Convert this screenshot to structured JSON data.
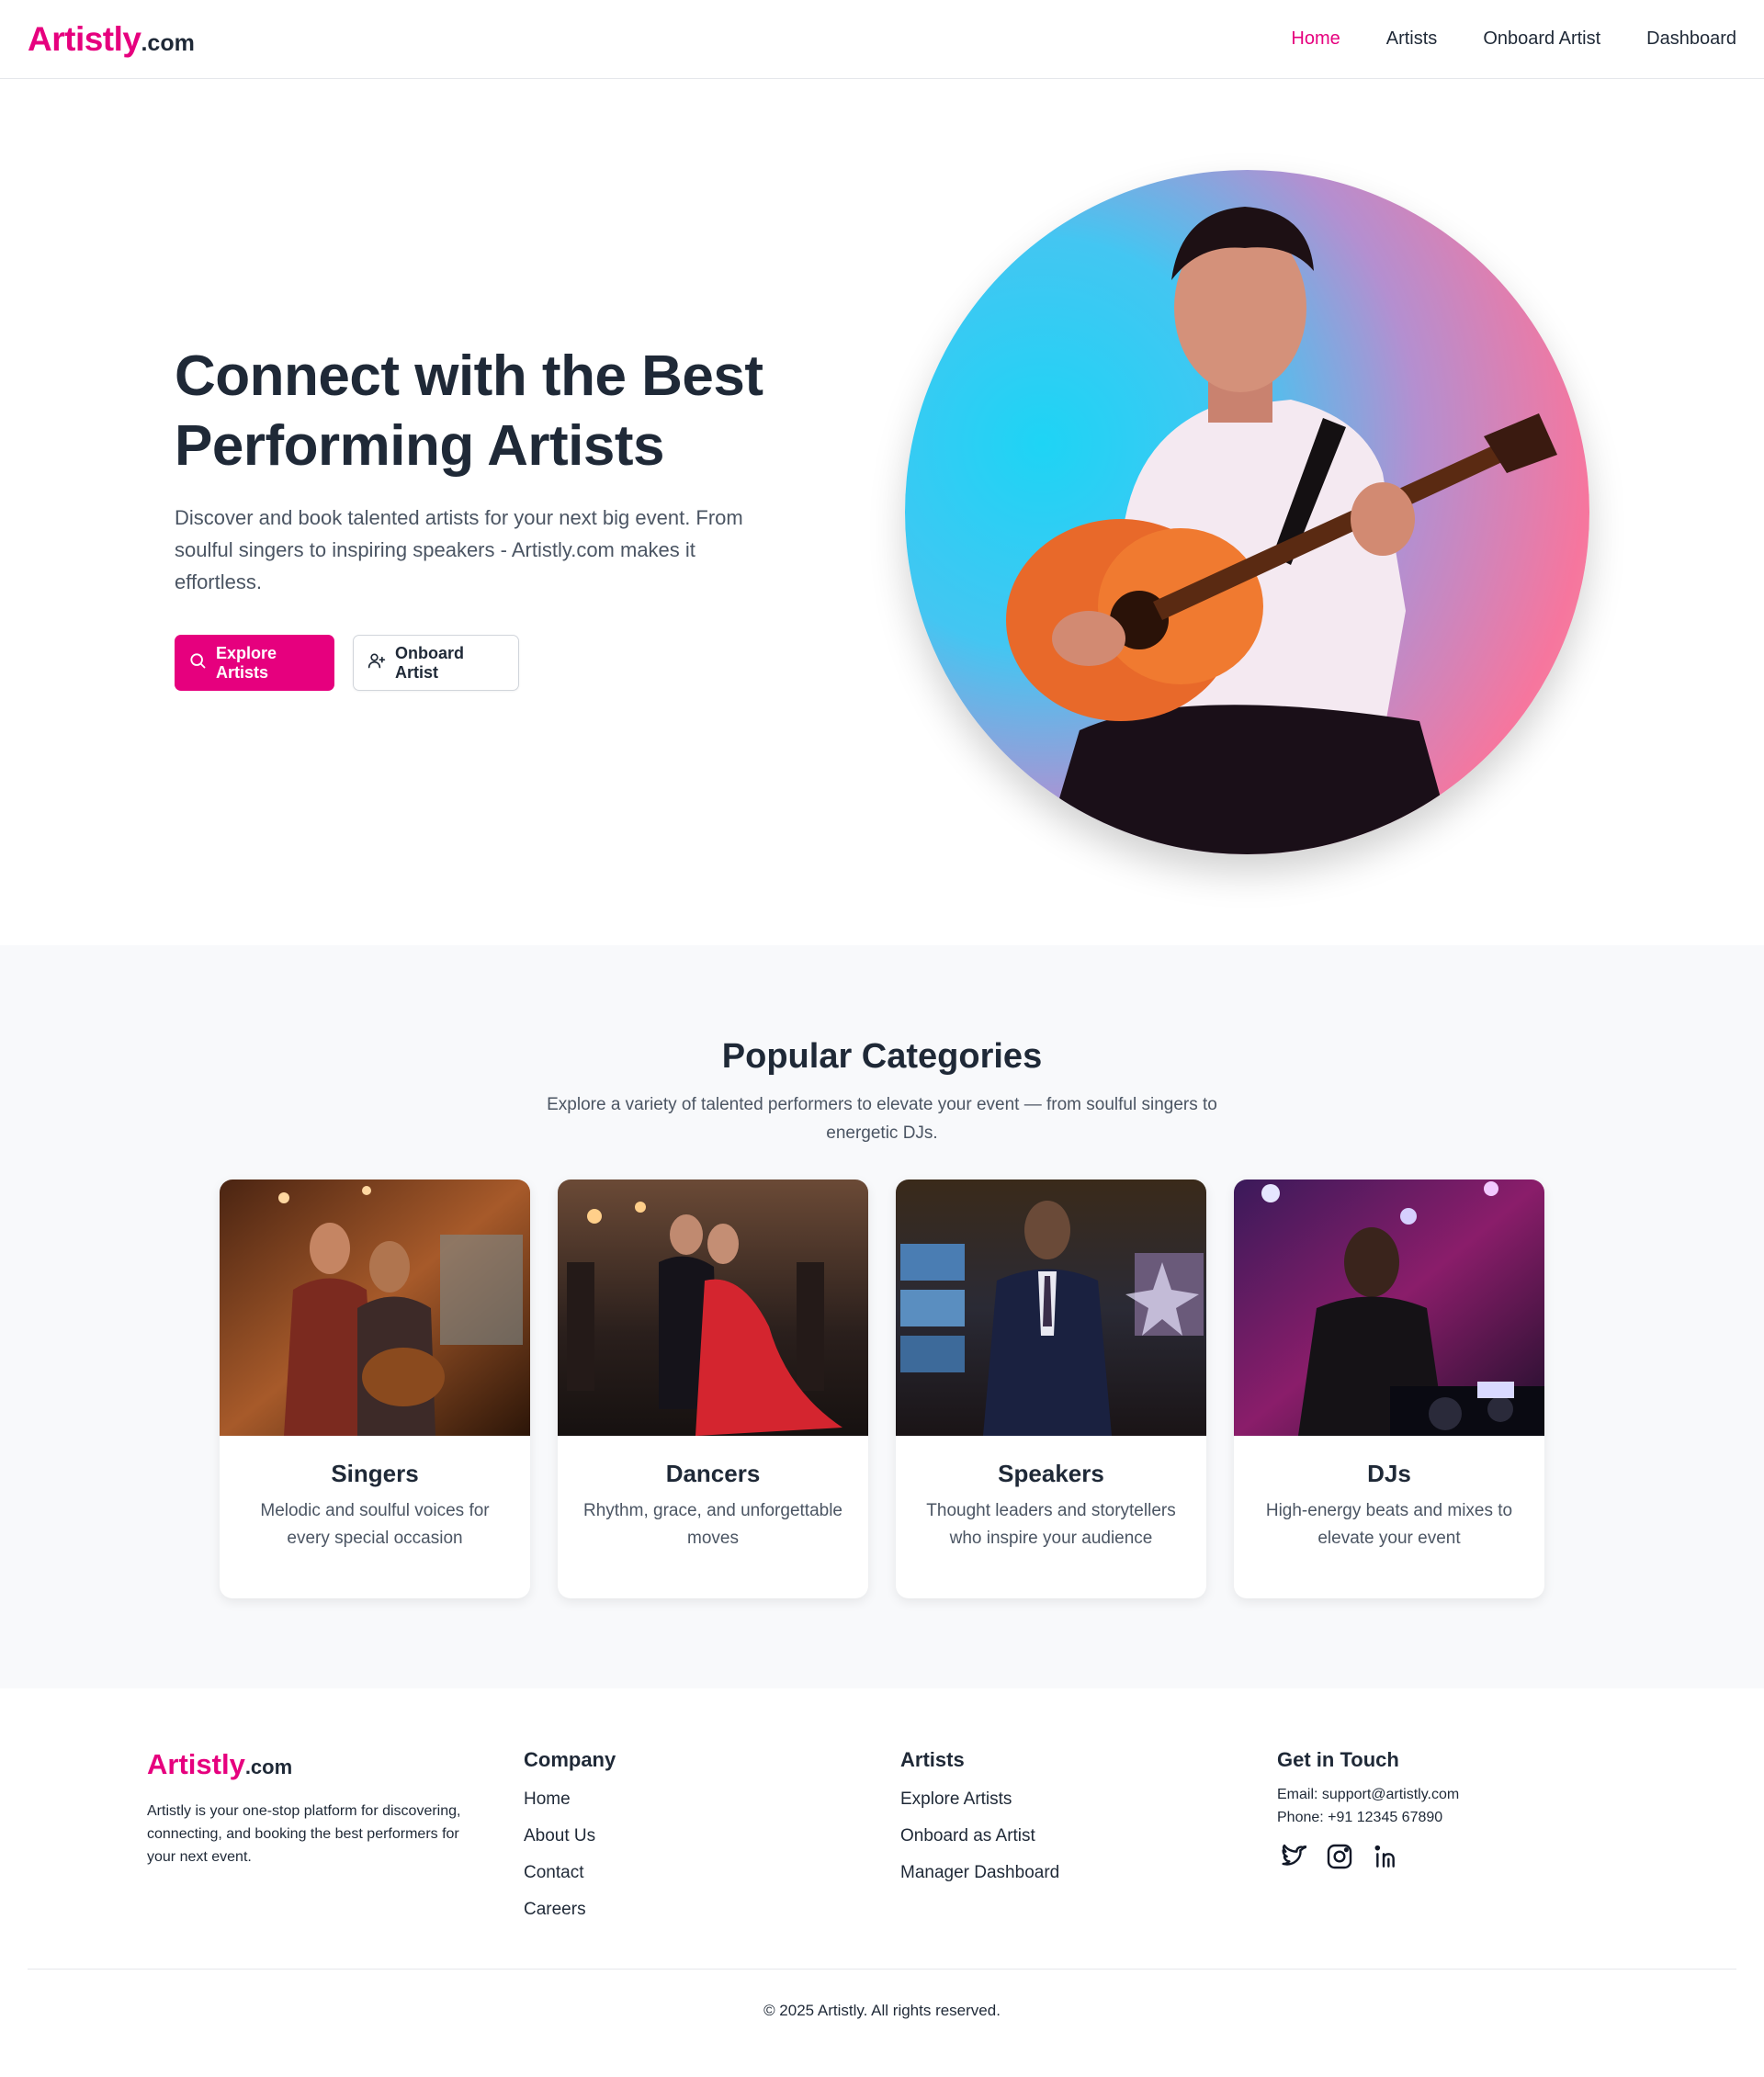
{
  "nav": {
    "brand": "Artistly",
    "tld": ".com",
    "links": [
      "Home",
      "Artists",
      "Onboard Artist",
      "Dashboard"
    ],
    "active": "Home"
  },
  "hero": {
    "title": "Connect with the Best Performing Artists",
    "subtitle": "Discover and book talented artists for your next big event. From soulful singers to inspiring speakers - Artistly.com makes it effortless.",
    "primary_button": "Explore Artists",
    "secondary_button": "Onboard Artist",
    "primary_icon": "search-icon",
    "secondary_icon": "user-plus-icon"
  },
  "categories": {
    "title": "Popular Categories",
    "subtitle": "Explore a variety of talented performers to elevate your event — from soulful singers to energetic DJs.",
    "items": [
      {
        "title": "Singers",
        "desc": "Melodic and soulful voices for every special occasion"
      },
      {
        "title": "Dancers",
        "desc": "Rhythm, grace, and unforgettable moves"
      },
      {
        "title": "Speakers",
        "desc": "Thought leaders and storytellers who inspire your audience"
      },
      {
        "title": "DJs",
        "desc": "High-energy beats and mixes to elevate your event"
      }
    ]
  },
  "footer": {
    "brand": "Artistly",
    "tld": ".com",
    "description": "Artistly is your one-stop platform for discovering, connecting, and booking the best performers for your next event.",
    "company_heading": "Company",
    "company_links": [
      "Home",
      "About Us",
      "Contact",
      "Careers"
    ],
    "artists_heading": "Artists",
    "artists_links": [
      "Explore Artists",
      "Onboard as Artist",
      "Manager Dashboard"
    ],
    "contact_heading": "Get in Touch",
    "email": "Email: support@artistly.com",
    "phone": "Phone: +91 12345 67890",
    "social_icons": [
      "twitter-icon",
      "instagram-icon",
      "linkedin-icon"
    ],
    "copyright": "© 2025 Artistly. All rights reserved."
  },
  "colors": {
    "brand": "#e6007e",
    "text": "#1f2937",
    "muted": "#4b5563",
    "section_bg": "#f8f9fb"
  }
}
